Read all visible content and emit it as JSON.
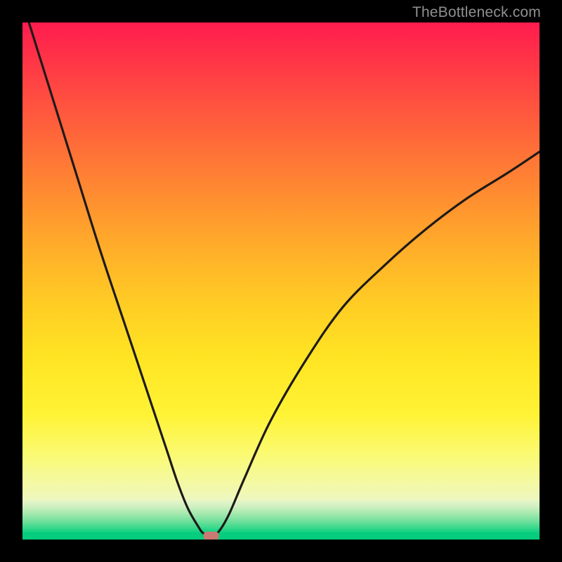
{
  "watermark": "TheBottleneck.com",
  "chart_data": {
    "type": "line",
    "title": "",
    "xlabel": "",
    "ylabel": "",
    "xlim": [
      0,
      100
    ],
    "ylim": [
      0,
      100
    ],
    "grid": false,
    "legend": false,
    "series": [
      {
        "name": "bottleneck-curve",
        "x": [
          0,
          5,
          10,
          15,
          20,
          25,
          28,
          30,
          32,
          34,
          35,
          36.5,
          38,
          40,
          43,
          48,
          55,
          62,
          70,
          78,
          86,
          94,
          100
        ],
        "y": [
          104,
          88,
          72,
          56,
          41,
          26,
          17,
          11,
          6,
          2.5,
          1.2,
          0.7,
          1.6,
          5,
          12,
          23,
          35,
          45,
          53,
          60,
          66,
          71,
          75
        ]
      }
    ],
    "annotations": [
      {
        "name": "minimum-marker",
        "x": 36.5,
        "y": 0.7
      }
    ]
  },
  "marker": {
    "path_key": "chart_data.annotations.0"
  },
  "colors": {
    "background": "#000000",
    "gradient_top": "#ff1c4e",
    "gradient_mid": "#ffcf24",
    "gradient_low": "#f4f9a0",
    "gradient_green": "#05cd7d",
    "curve": "#1e1a19",
    "marker": "#c97a73",
    "watermark": "#8f8f8f"
  }
}
